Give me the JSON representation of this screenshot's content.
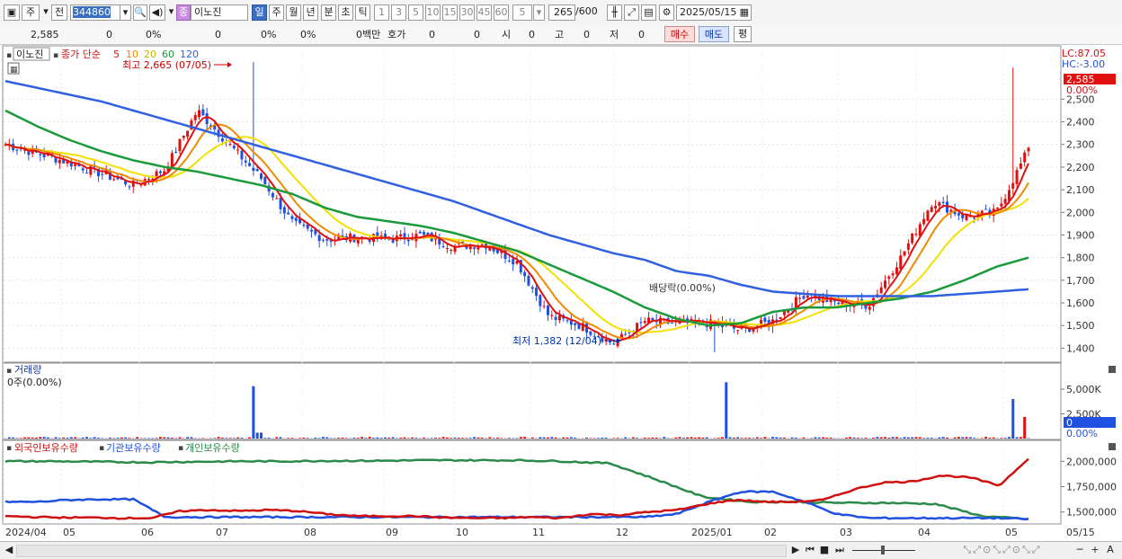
{
  "toolbar": {
    "market": "주",
    "prev_label": "전",
    "code": "344860",
    "stock_badge": "종",
    "stock_name": "이노진",
    "period_tabs": [
      "일",
      "주",
      "월",
      "년",
      "분",
      "초",
      "틱"
    ],
    "minute_options": [
      "1",
      "3",
      "5",
      "10",
      "15",
      "30",
      "45",
      "60"
    ],
    "custom_minute": "5",
    "count_value": "265",
    "count_total": "/600",
    "date": "2025/05/15"
  },
  "infobar": {
    "price": "2,585",
    "change": "0",
    "change_pct": "0%",
    "volume": "0",
    "vol_pct": "0%",
    "pct2": "0%",
    "amount": "0백만",
    "quote_label": "호가",
    "quote_val1": "0",
    "quote_val2": "0",
    "open_label": "시",
    "open_val": "0",
    "high_label": "고",
    "high_val": "0",
    "low_label": "저",
    "low_val": "0",
    "buy_label": "매수",
    "sell_label": "매도",
    "avg_label": "평"
  },
  "price_panel": {
    "stock_tab": "이노진",
    "legend_main": "종가 단순",
    "ma": [
      {
        "period": "5",
        "color": "#e01010"
      },
      {
        "period": "10",
        "color": "#f08a00"
      },
      {
        "period": "20",
        "color": "#e8d000"
      },
      {
        "period": "60",
        "color": "#1a9a3a"
      },
      {
        "period": "120",
        "color": "#3060e0"
      }
    ],
    "high_annot": "최고 2,665 (07/05)",
    "low_annot": "최저 1,382 (12/04)",
    "dividend_annot": "배당락(0.00%)",
    "lc": "LC:87.05",
    "hc": "HC:-3.00",
    "last_price": "2,585",
    "last_pct": "0.00%",
    "yticks": [
      "2,500",
      "2,400",
      "2,300",
      "2,200",
      "2,100",
      "2,000",
      "1,900",
      "1,800",
      "1,700",
      "1,600",
      "1,500",
      "1,400"
    ]
  },
  "volume_panel": {
    "title": "거래량",
    "current": "0주(0.00%)",
    "yticks": [
      "5,000K",
      "2,500K"
    ],
    "last_value": "0",
    "last_pct": "0.00%"
  },
  "holdings_panel": {
    "series": [
      {
        "name": "외국인보유수량",
        "color": "#d01010"
      },
      {
        "name": "기관보유수량",
        "color": "#2050e0"
      },
      {
        "name": "개인보유수량",
        "color": "#2a8a4a"
      }
    ],
    "yticks": [
      "2,000,000",
      "1,750,000",
      "1,500,000"
    ]
  },
  "xaxis": {
    "labels": [
      "2024/04",
      "05",
      "06",
      "07",
      "08",
      "09",
      "10",
      "11",
      "12",
      "2025/01",
      "02",
      "03",
      "04",
      "05"
    ],
    "end_label": "05/15"
  },
  "chart_data": [
    {
      "type": "line",
      "title": "",
      "series": [
        {
          "name": "5",
          "values": [
            2300,
            2260,
            2220,
            2170,
            2120,
            2190,
            2450,
            2300,
            2150,
            1950,
            1880,
            1890,
            1880,
            1900,
            1850,
            1860,
            1780,
            1540,
            1500,
            1420,
            1520,
            1510,
            1510,
            1480,
            1520,
            1640,
            1600,
            1590,
            1800,
            2050,
            1980,
            2000,
            2280
          ]
        },
        {
          "name": "60",
          "values": [
            2450,
            2380,
            2320,
            2270,
            2230,
            2200,
            2180,
            2150,
            2120,
            2080,
            2020,
            1980,
            1960,
            1940,
            1910,
            1870,
            1830,
            1770,
            1710,
            1650,
            1580,
            1530,
            1500,
            1510,
            1560,
            1580,
            1580,
            1600,
            1620,
            1650,
            1700,
            1760,
            1800
          ]
        },
        {
          "name": "120",
          "values": [
            2580,
            2550,
            2520,
            2490,
            2450,
            2410,
            2370,
            2330,
            2290,
            2250,
            2210,
            2170,
            2130,
            2090,
            2050,
            2000,
            1950,
            1900,
            1860,
            1820,
            1790,
            1740,
            1720,
            1680,
            1650,
            1640,
            1630,
            1630,
            1630,
            1630,
            1640,
            1650,
            1660
          ]
        }
      ],
      "ylim": [
        1350,
        2700
      ]
    },
    {
      "type": "bar",
      "title": "거래량",
      "spikes": [
        {
          "month": "07",
          "value": 5300
        },
        {
          "month": "01",
          "value": 5700
        },
        {
          "month": "05",
          "value": 4000
        }
      ],
      "ylim": [
        0,
        6000
      ]
    },
    {
      "type": "line",
      "series": [
        {
          "name": "외국인보유수량"
        },
        {
          "name": "기관보유수량"
        },
        {
          "name": "개인보유수량"
        }
      ],
      "ylim": [
        1400000,
        2100000
      ]
    }
  ],
  "bottombar": {
    "tools": [
      "▶",
      "⏮",
      "■",
      "⏭",
      "─",
      "+",
      "A"
    ]
  }
}
